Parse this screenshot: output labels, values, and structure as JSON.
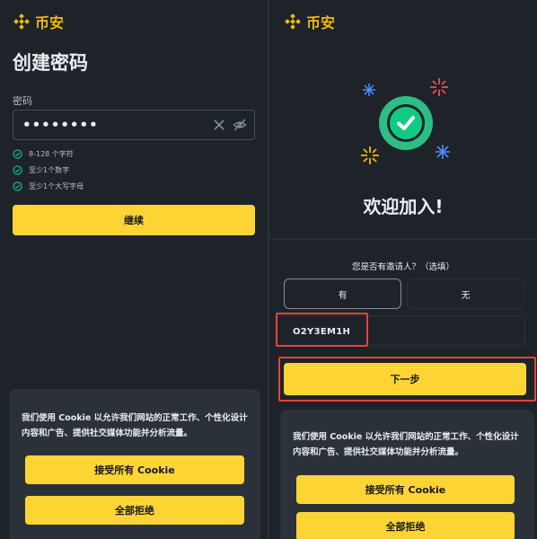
{
  "brand": {
    "name": "币安",
    "color": "#f0b90b"
  },
  "left": {
    "title": "创建密码",
    "password_label": "密码",
    "password_value": "••••••••",
    "rules": [
      "8-128 个字符",
      "至少1个数字",
      "至少1个大写字母"
    ],
    "continue_label": "继续"
  },
  "right": {
    "welcome": "欢迎加入!",
    "referral_question": "您是否有邀请人？（选填）",
    "option_yes": "有",
    "option_no": "无",
    "referral_code": "O2Y3EM1H",
    "next_label": "下一步"
  },
  "cookie": {
    "text": "我们使用 Cookie 以允许我们网站的正常工作、个性化设计内容和广告、提供社交媒体功能并分析流量。",
    "accept_label": "接受所有 Cookie",
    "reject_label": "全部拒绝"
  },
  "colors": {
    "accent": "#fcd535",
    "success": "#0ecb81",
    "background": "#1e2329",
    "highlight": "#e0443e"
  }
}
